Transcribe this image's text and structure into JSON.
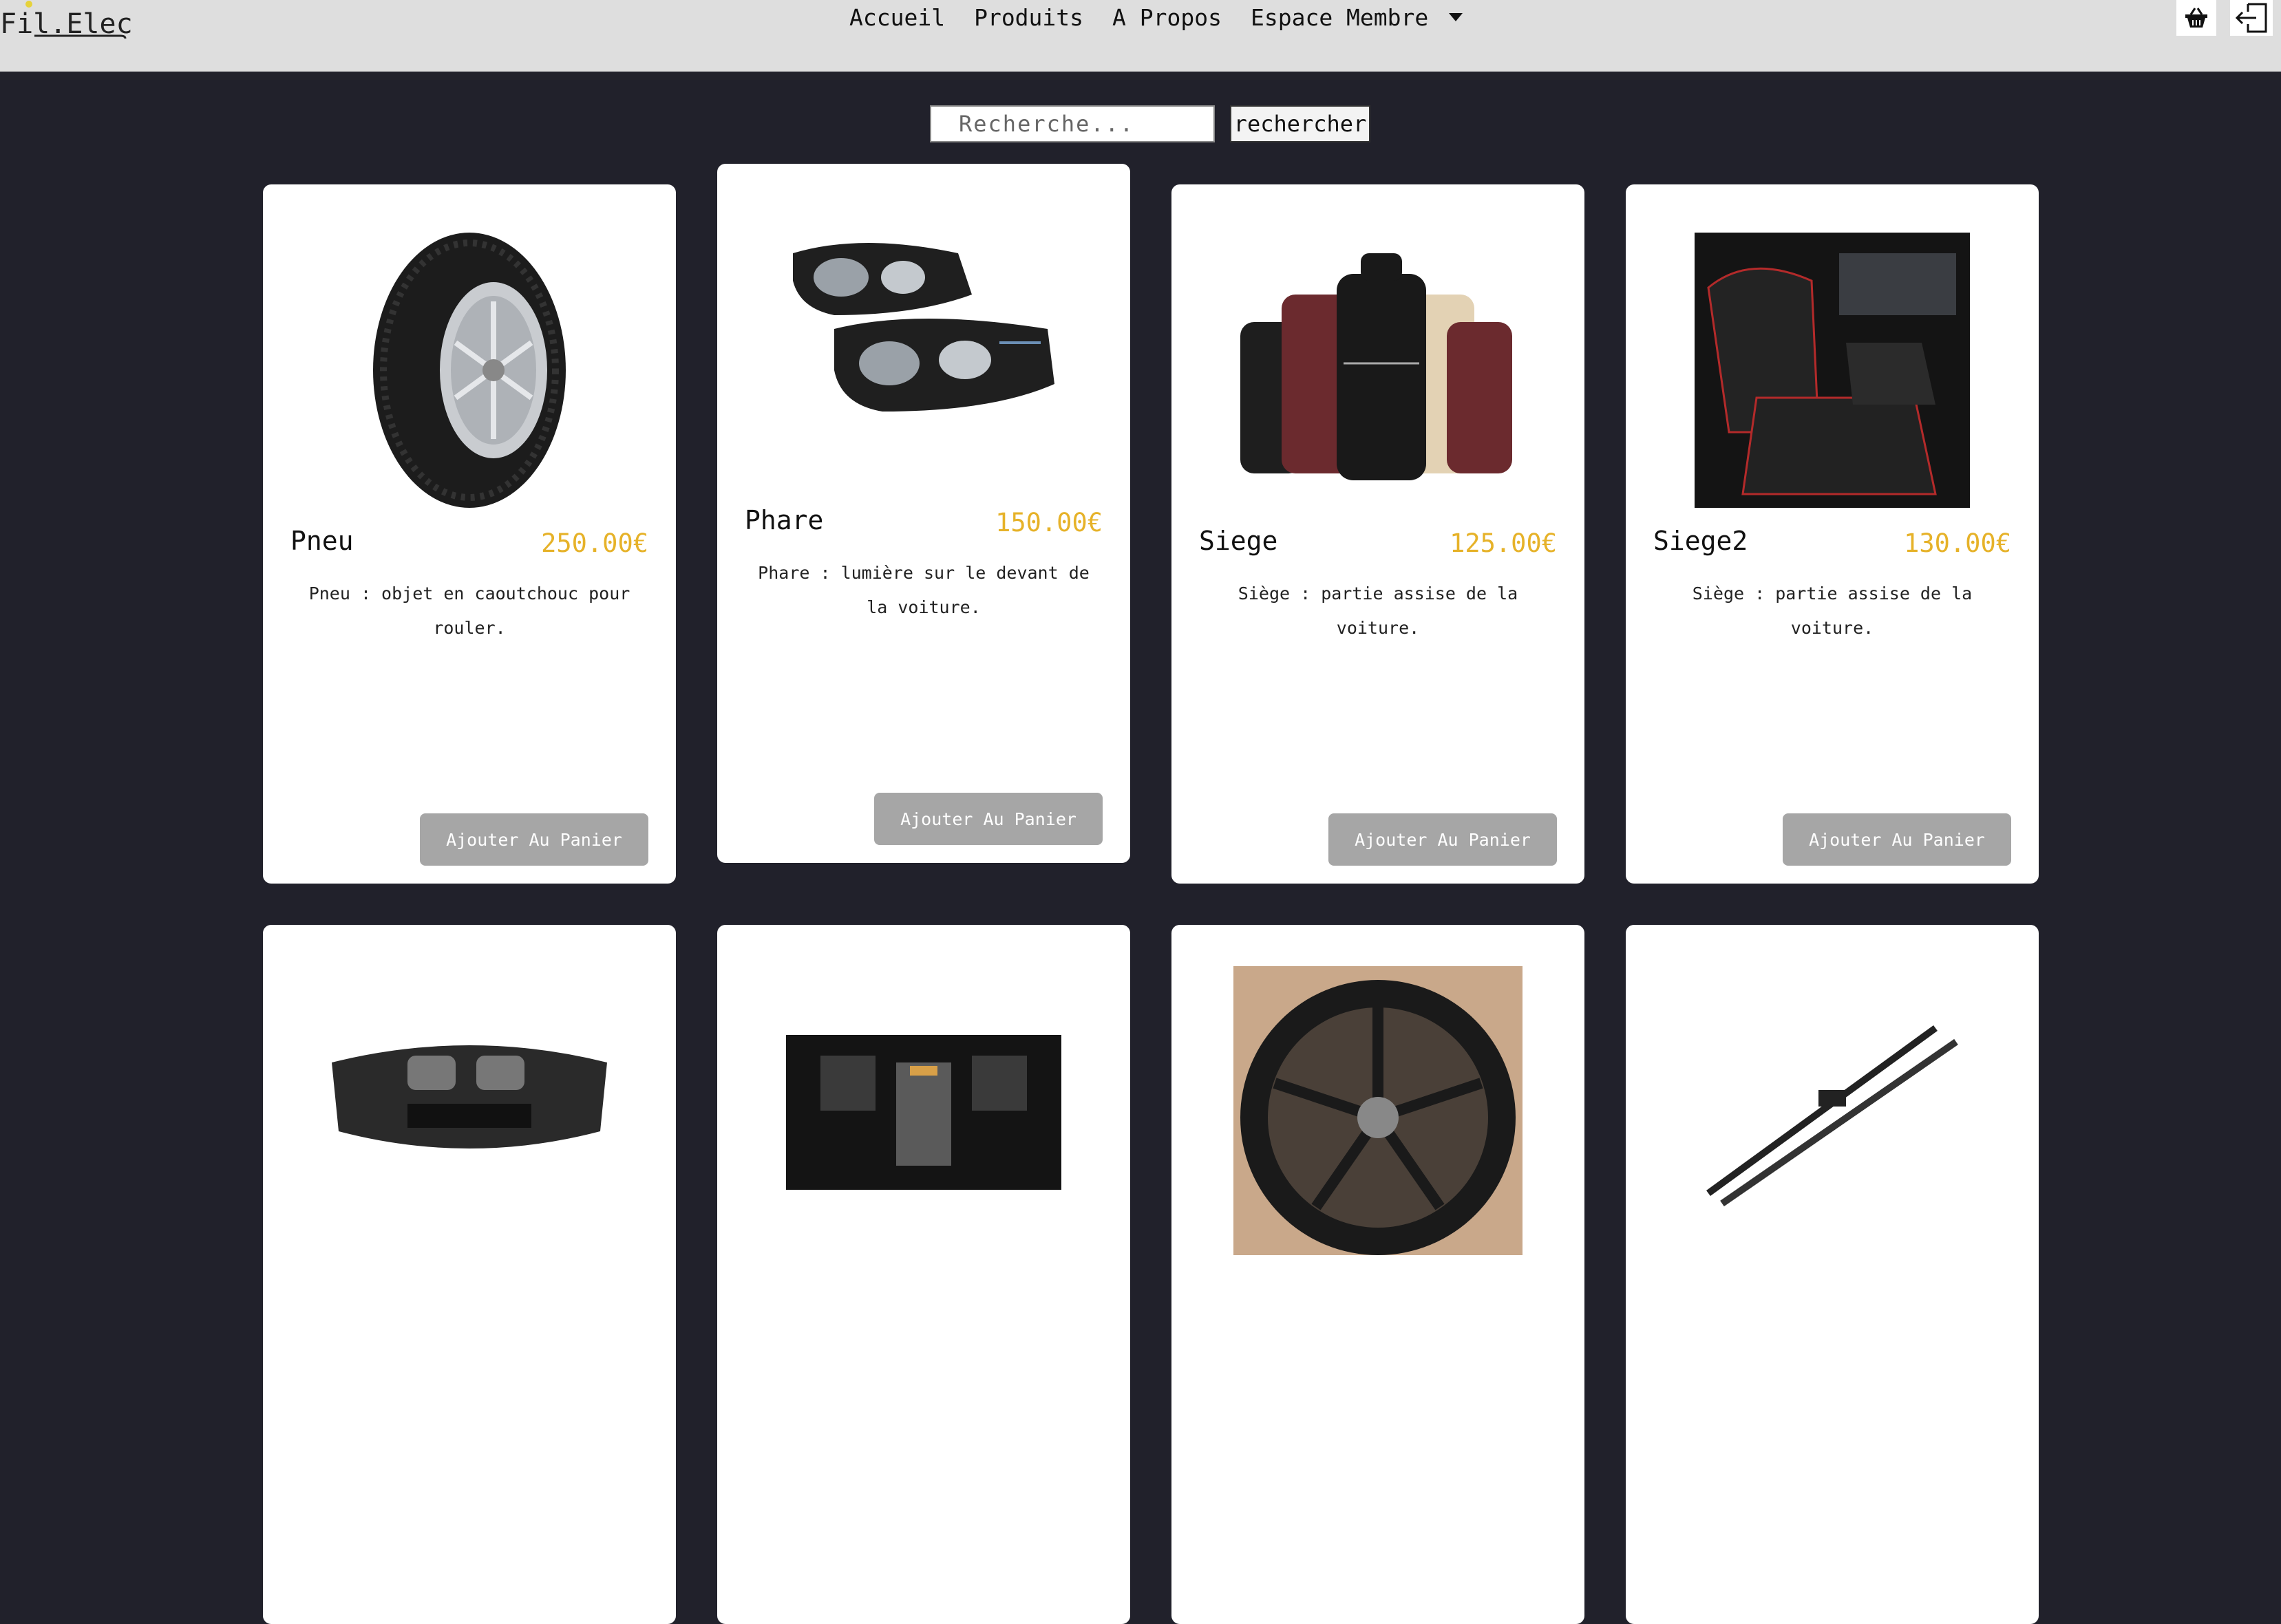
{
  "header": {
    "logo_text": "Fil.Elec",
    "nav": [
      "Accueil",
      "Produits",
      "A Propos",
      "Espace Membre"
    ],
    "icons": [
      "basket-icon",
      "logout-icon"
    ]
  },
  "search": {
    "placeholder": "Recherche...",
    "button_label": "rechercher"
  },
  "products": [
    {
      "name": "Pneu",
      "price": "250.00€",
      "description": "Pneu : objet en caoutchouc pour rouler.",
      "button": "Ajouter Au Panier"
    },
    {
      "name": "Phare",
      "price": "150.00€",
      "description": "Phare : lumière sur le devant de la voiture.",
      "button": "Ajouter Au Panier"
    },
    {
      "name": "Siege",
      "price": "125.00€",
      "description": "Siège : partie assise de la voiture.",
      "button": "Ajouter Au Panier"
    },
    {
      "name": "Siege2",
      "price": "130.00€",
      "description": "Siège : partie assise de la voiture.",
      "button": "Ajouter Au Panier"
    }
  ],
  "colors": {
    "background": "#21212b",
    "header": "#dedede",
    "price": "#e6b229",
    "button": "#a6a6a6"
  }
}
